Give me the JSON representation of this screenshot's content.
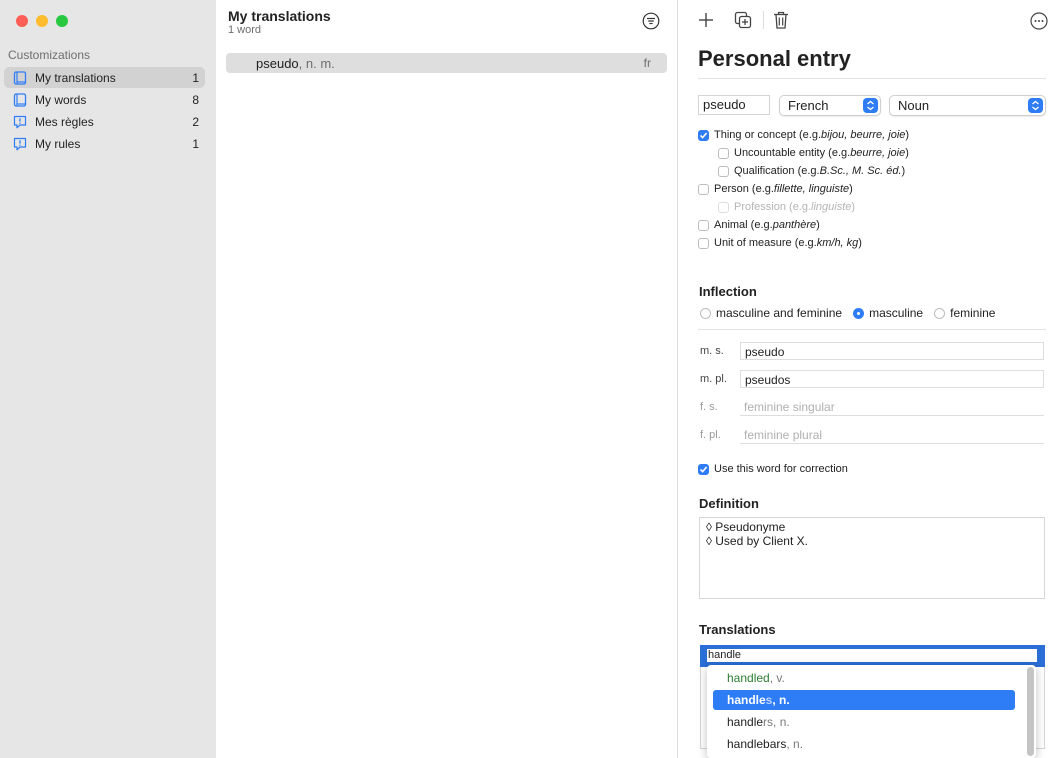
{
  "colors": {
    "accent": "#2f7df6",
    "close": "#ff5f57",
    "minimize": "#febc2e",
    "zoom": "#28c840"
  },
  "sidebar": {
    "section": "Customizations",
    "items": [
      {
        "label": "My translations",
        "count": "1",
        "icon": "book-icon",
        "selected": true
      },
      {
        "label": "My words",
        "count": "8",
        "icon": "book-icon"
      },
      {
        "label": "Mes règles",
        "count": "2",
        "icon": "rule-icon"
      },
      {
        "label": "My rules",
        "count": "1",
        "icon": "rule-icon"
      }
    ]
  },
  "list": {
    "title": "My translations",
    "subtitle": "1 word",
    "rows": [
      {
        "word": "pseudo",
        "pos": ", n. m.",
        "lang": "fr"
      }
    ]
  },
  "editor": {
    "heading": "Personal entry",
    "word": "pseudo",
    "language": "French",
    "category": "Noun",
    "semantic": [
      {
        "pre": "Thing or concept (e.g. ",
        "ex": "bijou, beurre, joie",
        "post": ")",
        "checked": true
      },
      {
        "pre": "Uncountable entity (e.g. ",
        "ex": "beurre, joie",
        "post": ")",
        "checked": false
      },
      {
        "pre": "Qualification (e.g. ",
        "ex": "B.Sc., M. Sc. éd.",
        "post": ")",
        "checked": false
      },
      {
        "pre": "Person (e.g. ",
        "ex": "fillette, linguiste",
        "post": ")",
        "checked": false
      },
      {
        "pre": "Profession (e.g. ",
        "ex": "linguiste",
        "post": ")",
        "checked": false
      },
      {
        "pre": "Animal (e.g. ",
        "ex": "panthère",
        "post": ")",
        "checked": false
      },
      {
        "pre": "Unit of measure (e.g. ",
        "ex": "km/h, kg",
        "post": ")",
        "checked": false
      }
    ],
    "inflection": {
      "title": "Inflection",
      "options": [
        "masculine and feminine",
        "masculine",
        "feminine"
      ],
      "selected": "masculine",
      "fields": [
        {
          "label": "m. s.",
          "value": "pseudo",
          "placeholder": ""
        },
        {
          "label": "m. pl.",
          "value": "pseudos",
          "placeholder": ""
        },
        {
          "label": "f. s.",
          "value": "",
          "placeholder": "feminine singular"
        },
        {
          "label": "f. pl.",
          "value": "",
          "placeholder": "feminine plural"
        }
      ]
    },
    "correction_label": "Use this word for correction",
    "correction_checked": true,
    "definition": {
      "title": "Definition",
      "lines": [
        "◊ Pseudonyme",
        "◊ Used by Client X."
      ]
    },
    "translations": {
      "title": "Translations",
      "input": "handle",
      "suggestions": [
        {
          "prefix": "handle",
          "suffix": "d",
          "pos": ", v."
        },
        {
          "prefix": "handle",
          "suffix": "s",
          "pos": ", n."
        },
        {
          "prefix": "handle",
          "suffix": "rs",
          "pos": ", n."
        },
        {
          "prefix": "handle",
          "suffix": "bars",
          "pos": ", n."
        }
      ]
    }
  }
}
